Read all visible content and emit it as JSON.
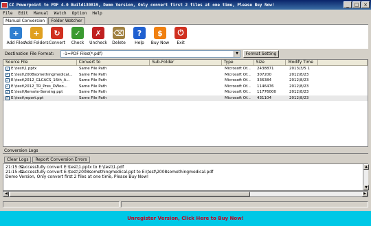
{
  "window": {
    "title": "CZ Powerpoint to PDF 4.0 Build130819, Demo Version, Only convert first 2 files at one time, Please Buy Now!",
    "controls": [
      "_",
      "□",
      "×"
    ]
  },
  "menu": [
    "File",
    "Edit",
    "Manual",
    "Watch",
    "Option",
    "Help"
  ],
  "tabs": [
    "Manual Conversion",
    "Folder Watcher"
  ],
  "toolbar": [
    {
      "label": "Add Files",
      "icon": "add-files-icon",
      "color": "#2f7fd0",
      "glyph": "+"
    },
    {
      "label": "Add Folders",
      "icon": "add-folders-icon",
      "color": "#e0a020",
      "glyph": "+"
    },
    {
      "label": "Convert",
      "icon": "convert-icon",
      "color": "#d03020",
      "glyph": "↻"
    },
    {
      "label": "Check",
      "icon": "check-icon",
      "color": "#3a9a30",
      "glyph": "✓"
    },
    {
      "label": "Uncheck",
      "icon": "uncheck-icon",
      "color": "#c02020",
      "glyph": "✗"
    },
    {
      "label": "Delete",
      "icon": "delete-icon",
      "color": "#a08040",
      "glyph": "⌫"
    },
    {
      "label": "Help",
      "icon": "help-icon",
      "color": "#2060d0",
      "glyph": "?"
    },
    {
      "label": "Buy Now",
      "icon": "buy-now-icon",
      "color": "#f08010",
      "glyph": "$"
    },
    {
      "label": "Exit",
      "icon": "exit-icon",
      "color": "#d03020",
      "glyph": "⏻"
    }
  ],
  "destination": {
    "label": "Destination File Format:",
    "value": "-1=PDF Files(*.pdf)",
    "format_button": "Format Setting"
  },
  "file_table": {
    "columns": [
      "Source File",
      "Convert to",
      "Sub-Folder",
      "Type",
      "Size",
      "Modify Time"
    ],
    "rows": [
      {
        "source": "E:\\test\\1.pptx",
        "convert_to": "Same File Path",
        "sub_folder": "",
        "type": "Microsoft Of...",
        "size": "2438871",
        "modified": "2013/3/5 1",
        "checked": true
      },
      {
        "source": "E:\\test\\2008somethingmedical...",
        "convert_to": "Same File Path",
        "sub_folder": "",
        "type": "Microsoft Of...",
        "size": "307200",
        "modified": "2012/8/23",
        "checked": true
      },
      {
        "source": "E:\\test\\2012_GLCACS_16th_A...",
        "convert_to": "Same File Path",
        "sub_folder": "",
        "type": "Microsoft Of...",
        "size": "336384",
        "modified": "2012/8/23",
        "checked": true
      },
      {
        "source": "E:\\test\\2012_TR_Pres_DWoo...",
        "convert_to": "Same File Path",
        "sub_folder": "",
        "type": "Microsoft Of...",
        "size": "1146476",
        "modified": "2012/8/23",
        "checked": true
      },
      {
        "source": "E:\\test\\Remote-Sensing.ppt",
        "convert_to": "Same File Path",
        "sub_folder": "",
        "type": "Microsoft Of...",
        "size": "11776000",
        "modified": "2012/8/23",
        "checked": true
      },
      {
        "source": "E:\\test\\report.ppt",
        "convert_to": "Same File Path",
        "sub_folder": "",
        "type": "Microsoft Of...",
        "size": "431104",
        "modified": "2012/8/23",
        "checked": true,
        "selected": true
      }
    ]
  },
  "logs": {
    "label": "Conversion Logs",
    "clear_button": "Clear Logs",
    "report_button": "Report Conversion Errors",
    "lines": [
      {
        "time": "21:15:32",
        "text": "successfully convert E:\\test\\1.pptx to E:\\test\\1.pdf"
      },
      {
        "time": "21:15:42",
        "text": "successfully convert E:\\test\\2008somethingmedical.ppt to E:\\test\\2008somethingmedical.pdf"
      },
      {
        "time": "",
        "text": "Demo Version, Only convert first 2 files at one time, Please Buy Now!"
      }
    ]
  },
  "buy_banner": "Unregister Version, Click Here to Buy Now!"
}
